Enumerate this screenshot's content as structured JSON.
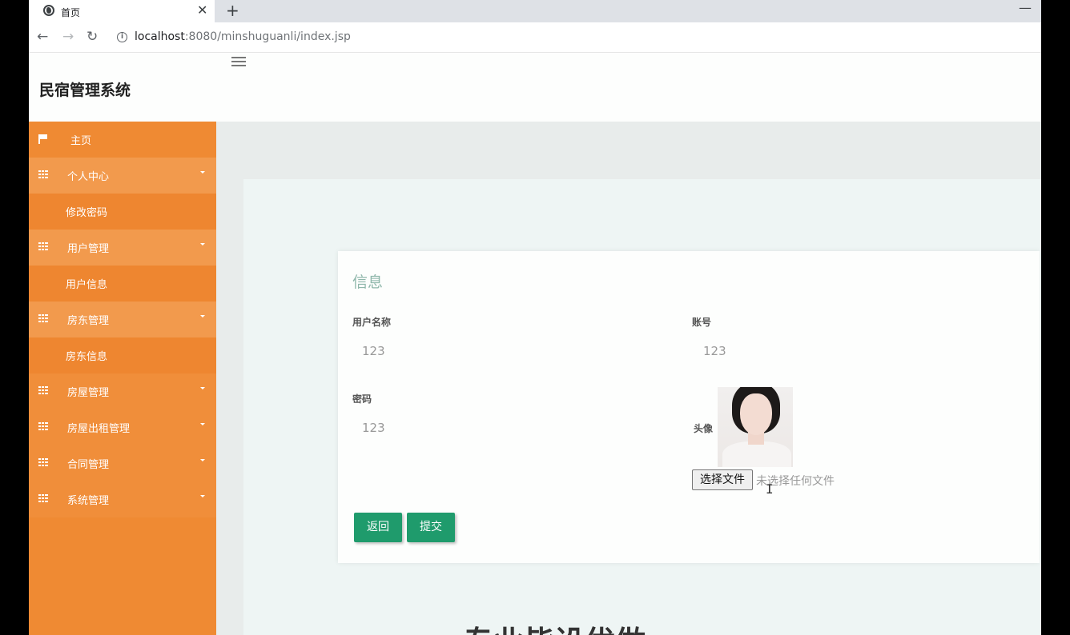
{
  "browser": {
    "tab_title": "首页",
    "tab_close": "✕",
    "new_tab": "+",
    "minimize": "—",
    "back": "←",
    "forward": "→",
    "reload": "↻",
    "info": "i",
    "url_host": "localhost",
    "url_rest": ":8080/minshuguanli/index.jsp"
  },
  "app": {
    "title": "民宿管理系统"
  },
  "sidebar": {
    "items": [
      {
        "label": "主页"
      },
      {
        "label": "个人中心"
      },
      {
        "label": "修改密码"
      },
      {
        "label": "用户管理"
      },
      {
        "label": "用户信息"
      },
      {
        "label": "房东管理"
      },
      {
        "label": "房东信息"
      },
      {
        "label": "房屋管理"
      },
      {
        "label": "房屋出租管理"
      },
      {
        "label": "合同管理"
      },
      {
        "label": "系统管理"
      }
    ]
  },
  "form": {
    "title": "信息",
    "username_label": "用户名称",
    "username_value": "123",
    "account_label": "账号",
    "account_value": "123",
    "password_label": "密码",
    "password_value": "123",
    "avatar_label": "头像",
    "file_button": "选择文件",
    "file_status": "未选择任何文件",
    "back_button": "返回",
    "submit_button": "提交"
  },
  "footer": {
    "banner_text": "专业皆设优做"
  },
  "colors": {
    "sidebar": "#ef8a33",
    "accent_green": "#1f9b6c",
    "title_teal": "#8fb7ab"
  }
}
